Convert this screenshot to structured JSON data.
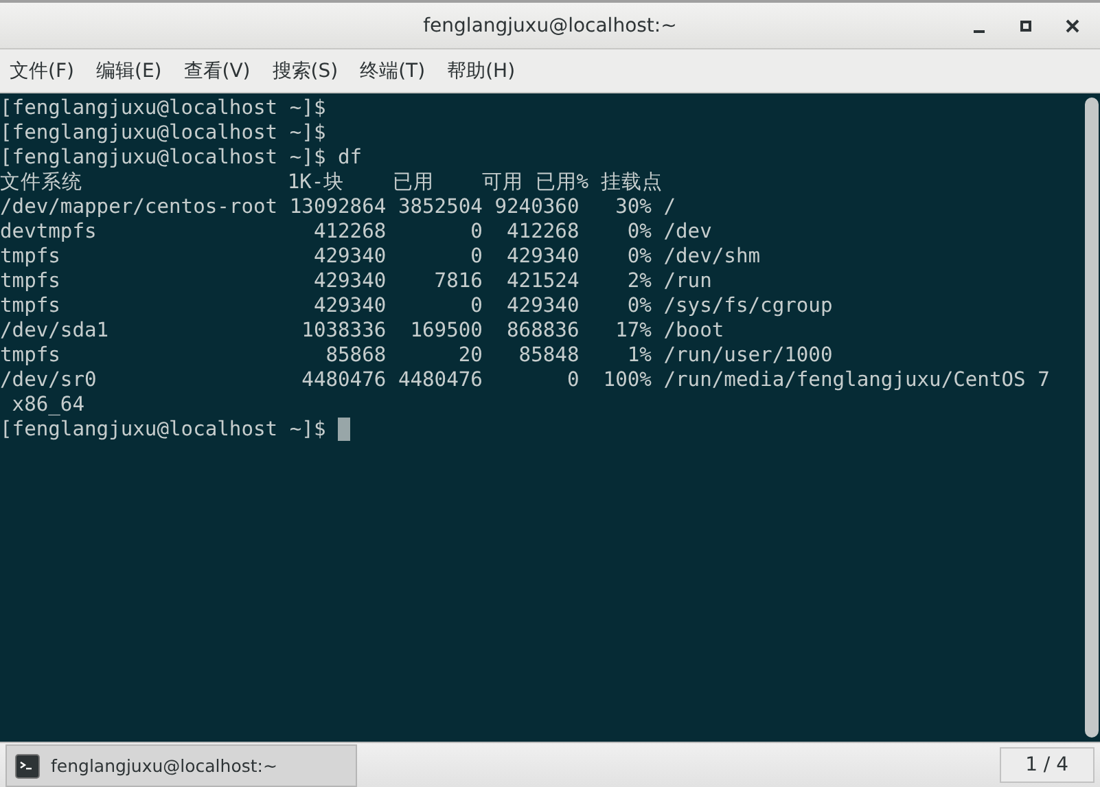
{
  "window": {
    "title": "fenglangjuxu@localhost:~"
  },
  "menu": [
    "文件(F)",
    "编辑(E)",
    "查看(V)",
    "搜索(S)",
    "终端(T)",
    "帮助(H)"
  ],
  "terminal": {
    "lines": [
      "[fenglangjuxu@localhost ~]$",
      "[fenglangjuxu@localhost ~]$",
      "[fenglangjuxu@localhost ~]$ df",
      "文件系统                 1K-块    已用    可用 已用% 挂载点",
      "/dev/mapper/centos-root 13092864 3852504 9240360   30% /",
      "devtmpfs                  412268       0  412268    0% /dev",
      "tmpfs                     429340       0  429340    0% /dev/shm",
      "tmpfs                     429340    7816  421524    2% /run",
      "tmpfs                     429340       0  429340    0% /sys/fs/cgroup",
      "/dev/sda1                1038336  169500  868836   17% /boot",
      "tmpfs                      85868      20   85848    1% /run/user/1000",
      "/dev/sr0                 4480476 4480476       0  100% /run/media/fenglangjuxu/CentOS 7",
      " x86_64",
      "[fenglangjuxu@localhost ~]$"
    ],
    "cursor": true
  },
  "taskbar": {
    "items": [
      {
        "label": "fenglangjuxu@localhost:~",
        "selected": true
      }
    ],
    "workspace": "1 / 4"
  }
}
